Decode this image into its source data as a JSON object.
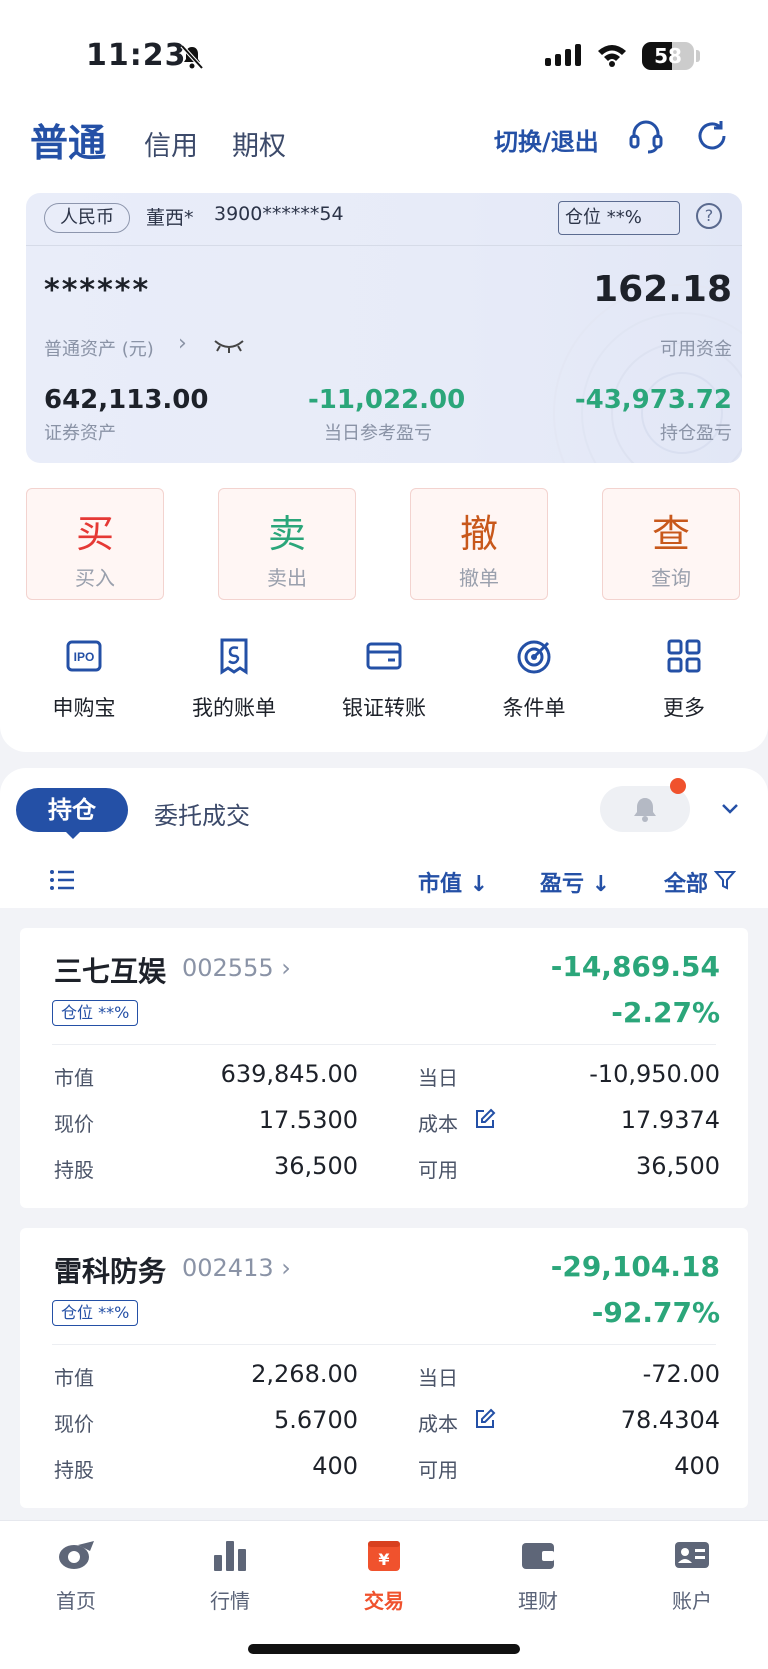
{
  "status_bar": {
    "time": "11:23",
    "battery": "58"
  },
  "header": {
    "tabs": [
      "普通",
      "信用",
      "期权"
    ],
    "switch_label": "切换/退出"
  },
  "asset": {
    "currency": "人民币",
    "account_name": "董西*",
    "account_number": "3900******54",
    "position_chip": "仓位 **%",
    "help": "?",
    "total_masked": "******",
    "total_label": "普通资产 (元)",
    "available_value": "162.18",
    "available_label": "可用资金",
    "securities_value": "642,113.00",
    "securities_label": "证券资产",
    "today_pnl_value": "-11,022.00",
    "today_pnl_label": "当日参考盈亏",
    "position_pnl_value": "-43,973.72",
    "position_pnl_label": "持仓盈亏"
  },
  "actions": [
    {
      "big": "买",
      "small": "买入",
      "color": "#e53935"
    },
    {
      "big": "卖",
      "small": "卖出",
      "color": "#2ba67a"
    },
    {
      "big": "撤",
      "small": "撤单",
      "color": "#c8581b"
    },
    {
      "big": "查",
      "small": "查询",
      "color": "#c8581b"
    }
  ],
  "quick_links": [
    "申购宝",
    "我的账单",
    "银证转账",
    "条件单",
    "更多"
  ],
  "holdings": {
    "tab_active": "持仓",
    "tab_other": "委托成交",
    "sort_market": "市值 ↓",
    "sort_pnl": "盈亏 ↓",
    "filter": "全部",
    "stocks": [
      {
        "name": "三七互娱",
        "code": "002555 ›",
        "pnl": "-14,869.54",
        "pct": "-2.27%",
        "chip": "仓位 **%",
        "market_label": "市值",
        "market": "639,845.00",
        "today_label": "当日",
        "today": "-10,950.00",
        "price_label": "现价",
        "price": "17.5300",
        "cost_label": "成本",
        "cost": "17.9374",
        "shares_label": "持股",
        "shares": "36,500",
        "avail_label": "可用",
        "avail": "36,500"
      },
      {
        "name": "雷科防务",
        "code": "002413 ›",
        "pnl": "-29,104.18",
        "pct": "-92.77%",
        "chip": "仓位 **%",
        "market_label": "市值",
        "market": "2,268.00",
        "today_label": "当日",
        "today": "-72.00",
        "price_label": "现价",
        "price": "5.6700",
        "cost_label": "成本",
        "cost": "78.4304",
        "shares_label": "持股",
        "shares": "400",
        "avail_label": "可用",
        "avail": "400"
      }
    ]
  },
  "nav": [
    "首页",
    "行情",
    "交易",
    "理财",
    "账户"
  ],
  "colors": {
    "brand": "#2450a6",
    "loss": "#2ba67a",
    "accent": "#f0522d"
  }
}
